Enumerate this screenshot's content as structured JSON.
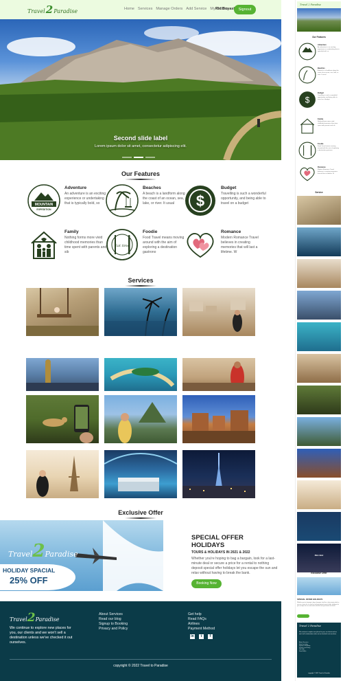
{
  "nav": {
    "logo_left": "Travel",
    "logo_number": "2",
    "logo_right": "Paradise",
    "links": [
      "Home",
      "Services",
      "Manage Orders",
      "Add Service",
      "My Orders"
    ],
    "user_name": "Rid Boyash",
    "signout_label": "Signout"
  },
  "hero": {
    "label": "Second slide label",
    "text": "Lorem ipsum dolor sit amet, consectetur adipiscing elit."
  },
  "features": {
    "title": "Our Features",
    "items": [
      {
        "title": "Adventure",
        "desc": "An adventure is an exciting experience or undertaking that is typically bold, so",
        "icon": "mountain-expedition-icon"
      },
      {
        "title": "Beaches",
        "desc": "A beach is a landform along the coast of an ocean, sea, lake, or river. It usual",
        "icon": "beach-swing-icon"
      },
      {
        "title": "Budget",
        "desc": "Travelling is such a wonderful opportunity, and being able to travel on a budget",
        "icon": "dollar-coin-icon"
      },
      {
        "title": "Family",
        "desc": "Nothing forms more vivid childhood memories than time spent with parents and sib",
        "icon": "family-home-icon"
      },
      {
        "title": "Foodie",
        "desc": "Food Travel means moving around with the aim of exploring a destination gastrono",
        "icon": "fork-knife-plate-icon"
      },
      {
        "title": "Romance",
        "desc": "Modern Romance Travel believes in creating memories that will last a lifetime. W",
        "icon": "hearts-icon"
      }
    ],
    "badge_mountain_top": "MOUNTAIN",
    "badge_mountain_bottom": "EXPEDITION",
    "badge_food": "Eat time"
  },
  "services": {
    "title": "Services"
  },
  "offer": {
    "section_title": "Exclusive Offer",
    "banner_line1": "HOLIDAY SPACIAL",
    "banner_line2": "25% OFF",
    "logo_left": "Travel",
    "logo_number": "2",
    "logo_right": "Paradise",
    "heading": "SPECIAL OFFER HOLIDAYS",
    "subheading": "TOURS & HOLIDAYS IN 2021 & 2022",
    "text": "Whether you're hoping to bag a bargain, look for a last-minute deal or secure a price for a rental to nothing deposit special offer holidays let you escape the sun and relax without having to break the bank.",
    "button_label": "Booking Now"
  },
  "footer": {
    "logo_left": "Travel",
    "logo_number": "2",
    "logo_right": "Paradise",
    "text": "We continue to explore new places for you, our clients and we won't sell a destination unless we've checked it out ourselves.",
    "col1": [
      "About Services",
      "Read our blog",
      "Signup to Booking",
      "Privacy and Policy"
    ],
    "col2": [
      "Get help",
      "Read FAQs",
      "Airlines",
      "Payment Method"
    ],
    "social": [
      "in",
      "t",
      "f"
    ],
    "copyright": "copyright © 2022 Travel to Paradise"
  },
  "preview": {
    "logo": "Travel 2 Paradise",
    "features_title": "Our Features",
    "services_title": "Service",
    "offer_title": "Exclusive Offer",
    "offer_heading": "SPECIAL OFFER HOLIDAYS",
    "hero_label": "Main label",
    "copyright": "copyright © 2022 Travel to Paradise"
  },
  "colors": {
    "accent": "#56b332",
    "nav_bg": "#ecfbe0",
    "footer_bg": "#0b3b48",
    "icon_green": "#27401f"
  }
}
